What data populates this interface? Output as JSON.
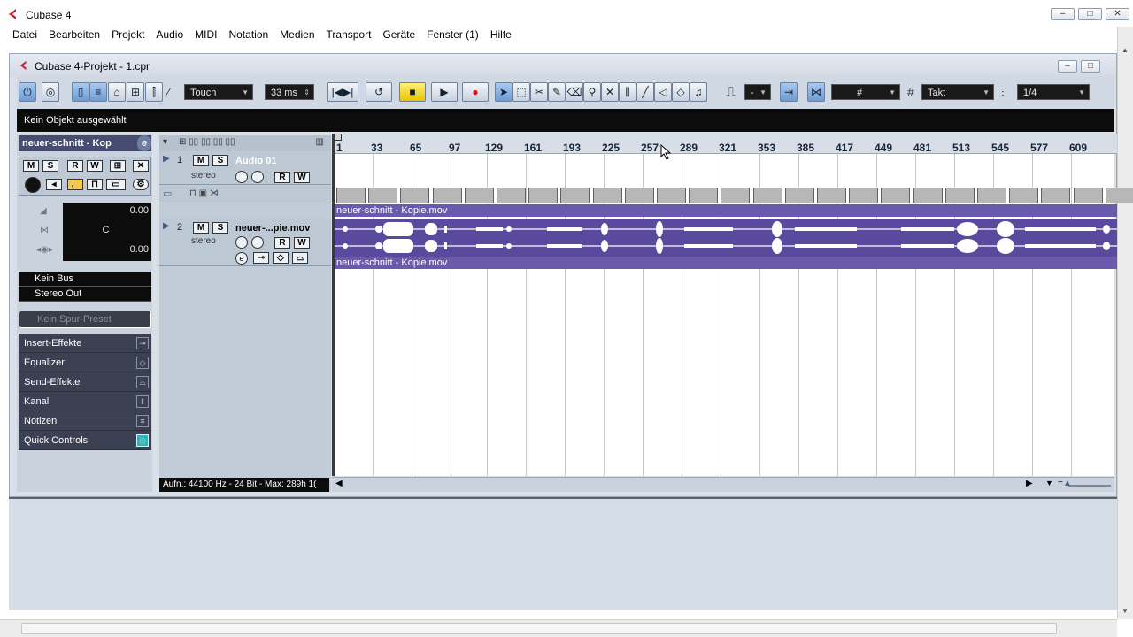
{
  "app": {
    "title": "Cubase 4",
    "menu": [
      "Datei",
      "Bearbeiten",
      "Projekt",
      "Audio",
      "MIDI",
      "Notation",
      "Medien",
      "Transport",
      "Geräte",
      "Fenster (1)",
      "Hilfe"
    ]
  },
  "project": {
    "title": "Cubase 4-Projekt - 1.cpr",
    "automation_mode": "Touch",
    "latency": "33 ms",
    "snap_value": "-",
    "grid_type": "Takt",
    "quantize": "1/4",
    "info_line": "Kein Objekt ausgewählt"
  },
  "inspector": {
    "track_name": "neuer-schnitt - Kop",
    "volume": "0.00",
    "pan": "C",
    "delay": "0.00",
    "input": "Kein Bus",
    "output": "Stereo Out",
    "preset_placeholder": "Kein Spur-Preset",
    "sections": [
      "Insert-Effekte",
      "Equalizer",
      "Send-Effekte",
      "Kanal",
      "Notizen",
      "Quick Controls"
    ]
  },
  "tracks": [
    {
      "num": "1",
      "name": "Audio 01",
      "sub": "stereo"
    },
    {
      "num": "2",
      "name": "neuer-...pie.mov",
      "sub": "stereo"
    }
  ],
  "arrange": {
    "ruler_ticks": [
      "1",
      "33",
      "65",
      "97",
      "129",
      "161",
      "193",
      "225",
      "257",
      "289",
      "321",
      "353",
      "385",
      "417",
      "449",
      "481",
      "513",
      "545",
      "577",
      "609"
    ],
    "video_label": "neuer-schnitt - Kopie.mov",
    "audio_label": "neuer-schnitt - Kopie.mov"
  },
  "status": {
    "record_format": "Aufn.: 44100 Hz - 24 Bit - Max: 289h 1("
  },
  "colors": {
    "event_purple": "#6a5aab",
    "header_dark": "#0c0c0c",
    "window_bg": "#dae0e8"
  },
  "icons": {
    "record": "red-dot",
    "stop": "square",
    "play": "triangle",
    "cycle": "loop-arrow"
  }
}
